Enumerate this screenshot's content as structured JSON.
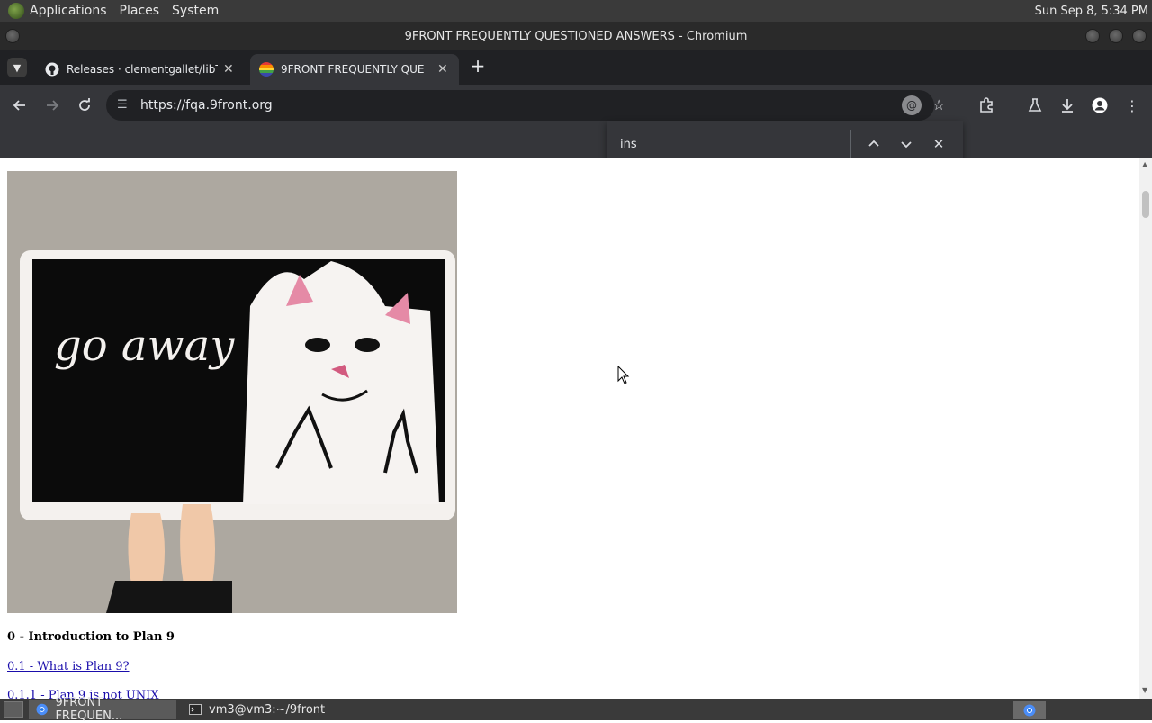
{
  "system_panel": {
    "menus": [
      "Applications",
      "Places",
      "System"
    ],
    "clock": "Sun Sep  8,  5:34 PM"
  },
  "window": {
    "title": "9FRONT FREQUENTLY QUESTIONED ANSWERS - Chromium"
  },
  "tabs": [
    {
      "label": "Releases · clementgallet/libT",
      "active": false
    },
    {
      "label": "9FRONT FREQUENTLY QUE",
      "active": true
    }
  ],
  "toolbar": {
    "url": "https://fqa.9front.org"
  },
  "find_bar": {
    "query": "ins"
  },
  "page": {
    "image_caption_text": "go away",
    "heading": "0 - Introduction to Plan 9",
    "links": [
      "0.1 - What is Plan 9?",
      "0.1.1 - Plan 9 is not UNIX"
    ]
  },
  "taskbar": {
    "tasks": [
      {
        "label": "9FRONT FREQUEN...",
        "active": true
      },
      {
        "label": "vm3@vm3:~/9front",
        "active": false
      }
    ]
  },
  "colors": {
    "panel": "#3a3a3a",
    "tab_strip": "#202124",
    "toolbar": "#35363a",
    "link": "#1a0dab"
  }
}
